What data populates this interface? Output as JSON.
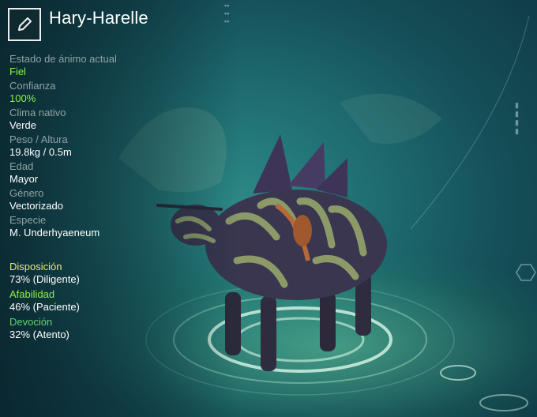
{
  "creature": {
    "name": "Hary-Harelle"
  },
  "stats": [
    {
      "label": "Estado de ánimo actual",
      "value": "Fiel",
      "highlight": true
    },
    {
      "label": "Confianza",
      "value": "100%",
      "highlight": true
    },
    {
      "label": "Clima nativo",
      "value": "Verde",
      "highlight": false
    },
    {
      "label": "Peso / Altura",
      "value": "19.8kg / 0.5m",
      "highlight": false
    },
    {
      "label": "Edad",
      "value": "Mayor",
      "highlight": false
    },
    {
      "label": "Género",
      "value": "Vectorizado",
      "highlight": false
    },
    {
      "label": "Especie",
      "value": "M. Underhyaeneum",
      "highlight": false
    }
  ],
  "traits": [
    {
      "label": "Disposición",
      "value": "73% (Diligente)",
      "color": "#e8e87a"
    },
    {
      "label": "Afabilidad",
      "value": "46% (Paciente)",
      "color": "#8ef04a"
    },
    {
      "label": "Devoción",
      "value": "32% (Atento)",
      "color": "#5ed66a"
    }
  ],
  "colors": {
    "accent_green": "#8ef04a",
    "label_gray": "#8fa3a6",
    "background": "#1e6c70"
  },
  "icons": {
    "edit": "pencil-icon"
  }
}
